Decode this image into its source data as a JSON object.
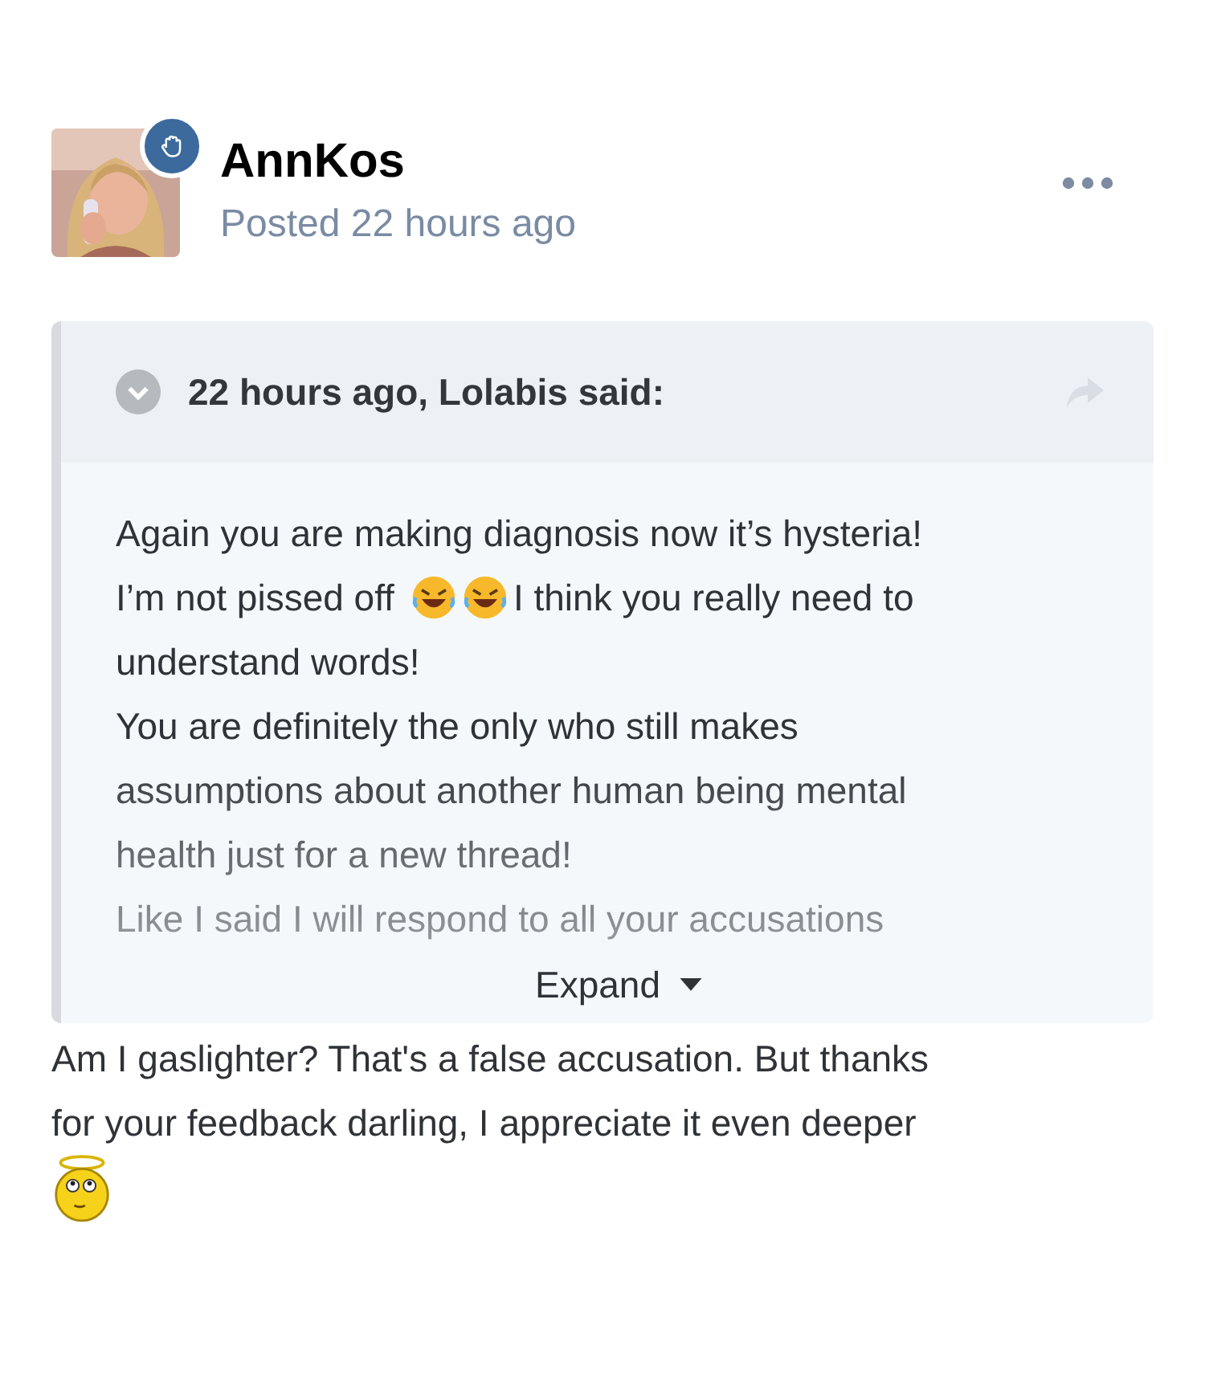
{
  "author": {
    "name": "AnnKos",
    "posted": "Posted 22 hours ago",
    "badge": true
  },
  "quote": {
    "header": "22 hours ago, Lolabis said:",
    "collapsed": true,
    "lines": [
      {
        "segments": [
          {
            "kind": "text",
            "text": "Again you are making diagnosis now it’s hysteria!"
          }
        ]
      },
      {
        "segments": [
          {
            "kind": "text",
            "text": "I’m not pissed off"
          },
          {
            "kind": "laugh"
          },
          {
            "kind": "laugh"
          },
          {
            "kind": "text",
            "text": "I think you really need to"
          }
        ]
      },
      {
        "segments": [
          {
            "kind": "text",
            "text": "understand words!"
          }
        ]
      },
      {
        "segments": [
          {
            "kind": "text",
            "text": "You are definitely the only who still makes"
          }
        ]
      },
      {
        "segments": [
          {
            "kind": "text",
            "text": "assumptions about another human being mental"
          }
        ]
      },
      {
        "segments": [
          {
            "kind": "text",
            "text": "health just for a new thread!"
          }
        ]
      },
      {
        "segments": [
          {
            "kind": "text",
            "text": "Like I said I will respond to all your accusations"
          }
        ]
      }
    ],
    "expand_label": "Expand"
  },
  "reply": [
    {
      "segments": [
        {
          "kind": "text",
          "text": "Am I gaslighter? That's a false accusation. But thanks"
        }
      ]
    },
    {
      "segments": [
        {
          "kind": "text",
          "text": "for your feedback darling, I appreciate it even deeper"
        }
      ]
    },
    {
      "segments": [
        {
          "kind": "angel"
        }
      ]
    }
  ]
}
